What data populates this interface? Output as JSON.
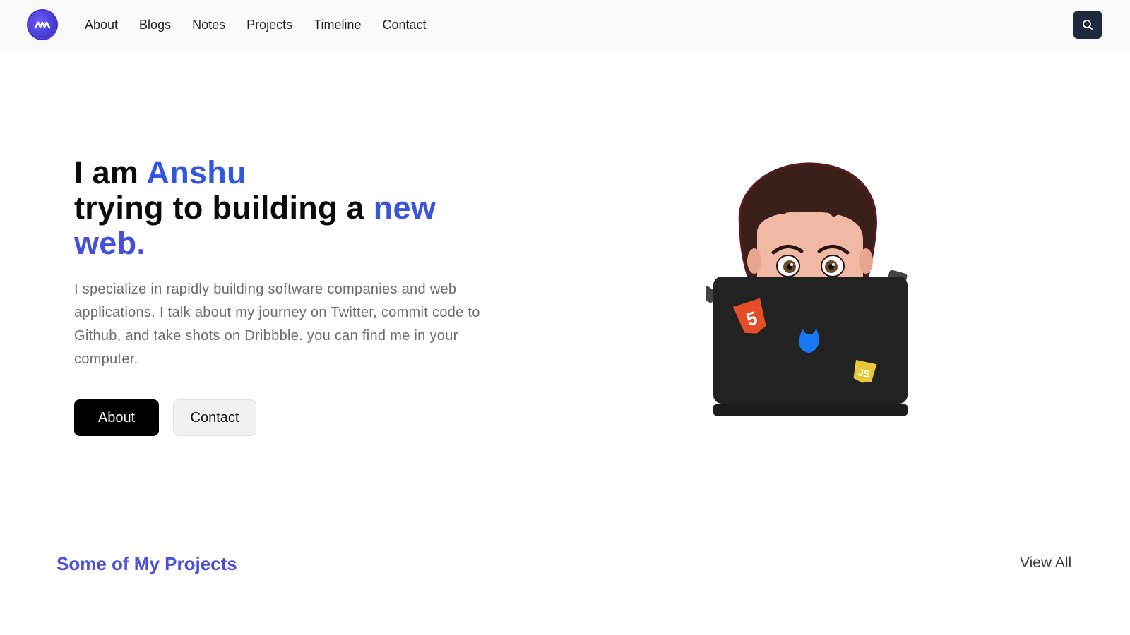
{
  "nav": {
    "logo_icon": "logo-wave-icon",
    "links": [
      "About",
      "Blogs",
      "Notes",
      "Projects",
      "Timeline",
      "Contact"
    ],
    "search_icon": "search-icon"
  },
  "hero": {
    "line1_prefix": "I am ",
    "name": "Anshu",
    "line2_prefix": "trying to building a ",
    "line2_accent": "new",
    "line3_accent": "web.",
    "description": "I specialize in rapidly building software companies and web applications. I talk about my journey on Twitter, commit code to Github, and take shots on Dribbble. you can find me in your computer.",
    "primary_button": "About",
    "secondary_button": "Contact"
  },
  "illustration": {
    "icon": "developer-avatar-laptop-illustration",
    "stickers": [
      "html5-sticker-icon",
      "blue-cat-sticker-icon",
      "js-sticker-icon"
    ],
    "html5_badge": "5",
    "js_badge": "JS"
  },
  "projects": {
    "title": "Some of My Projects",
    "view_all": "View All"
  },
  "colors": {
    "accent": "#3258e0",
    "section_title": "#4a50d8",
    "search_button_bg": "#1e293b",
    "navbar_bg": "#fafafa"
  }
}
